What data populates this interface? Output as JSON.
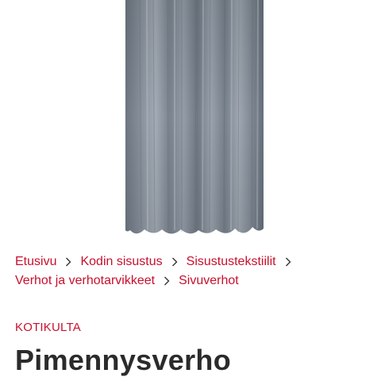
{
  "product": {
    "image_icon": "curtain-image",
    "image_color": "#7f8893"
  },
  "breadcrumb": {
    "items": [
      "Etusivu",
      "Kodin sisustus",
      "Sisustustekstiilit",
      "Verhot ja verhotarvikkeet",
      "Sivuverhot"
    ],
    "separator_icon": "chevron-right-icon",
    "link_color": "#c8102e"
  },
  "brand": "KOTIKULTA",
  "title": "Pimennysverho"
}
